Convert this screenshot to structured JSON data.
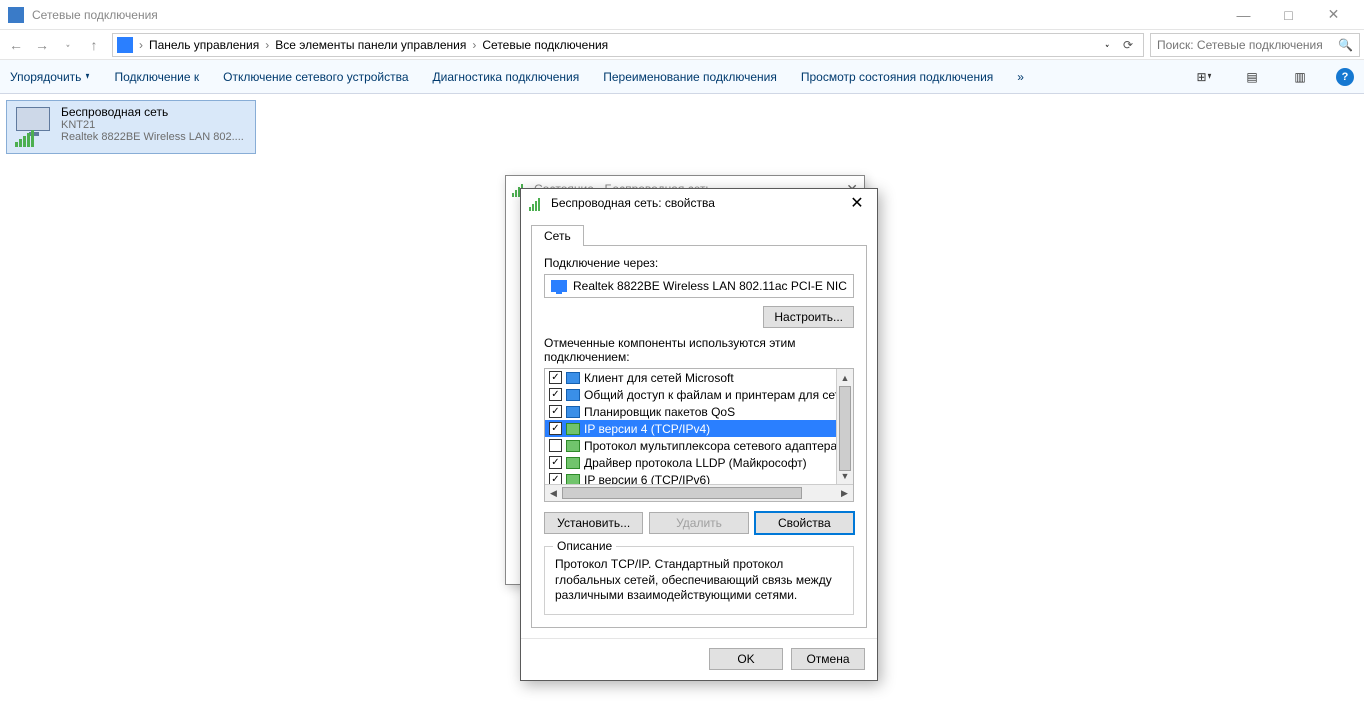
{
  "window": {
    "title": "Сетевые подключения",
    "controls": {
      "min": "—",
      "max": "□",
      "close": "✕"
    }
  },
  "nav": {
    "back": "←",
    "fwd": "→",
    "up": "↑",
    "crumbs": [
      "Панель управления",
      "Все элементы панели управления",
      "Сетевые подключения"
    ],
    "sep": "›",
    "dropdown": "⌄",
    "refresh": "⟳",
    "search_placeholder": "Поиск: Сетевые подключения",
    "search_icon": "🔍"
  },
  "cmd": {
    "organize": "Упорядочить",
    "connect": "Подключение к",
    "disable": "Отключение сетевого устройства",
    "diag": "Диагностика подключения",
    "rename": "Переименование подключения",
    "status": "Просмотр состояния подключения",
    "more": "»",
    "view1": "⊞",
    "view2": "▤",
    "view3": "▥"
  },
  "conn": {
    "name": "Беспроводная сеть",
    "ssid": "KNT21",
    "adapter": "Realtek 8822BE Wireless LAN 802...."
  },
  "status_dialog": {
    "title": "Состояние - Беспроводная сеть",
    "close": "✕"
  },
  "props_dialog": {
    "title": "Беспроводная сеть: свойства",
    "close": "✕",
    "tab": "Сеть",
    "connect_via": "Подключение через:",
    "adapter": "Realtek 8822BE Wireless LAN 802.11ac PCI-E NIC",
    "configure": "Настроить...",
    "components_label": "Отмеченные компоненты используются этим подключением:",
    "components": [
      {
        "checked": true,
        "iconClass": "ci-mon",
        "label": "Клиент для сетей Microsoft"
      },
      {
        "checked": true,
        "iconClass": "ci-mon",
        "label": "Общий доступ к файлам и принтерам для сетей Mi"
      },
      {
        "checked": true,
        "iconClass": "ci-mon",
        "label": "Планировщик пакетов QoS"
      },
      {
        "checked": true,
        "iconClass": "ci-net",
        "label": "IP версии 4 (TCP/IPv4)",
        "selected": true
      },
      {
        "checked": false,
        "iconClass": "ci-net",
        "label": "Протокол мультиплексора сетевого адаптера (Ма"
      },
      {
        "checked": true,
        "iconClass": "ci-net",
        "label": "Драйвер протокола LLDP (Майкрософт)"
      },
      {
        "checked": true,
        "iconClass": "ci-net",
        "label": "IP версии 6 (TCP/IPv6)"
      }
    ],
    "install": "Установить...",
    "remove": "Удалить",
    "properties": "Свойства",
    "desc_label": "Описание",
    "desc": "Протокол TCP/IP. Стандартный протокол глобальных сетей, обеспечивающий связь между различными взаимодействующими сетями.",
    "ok": "OK",
    "cancel": "Отмена"
  }
}
